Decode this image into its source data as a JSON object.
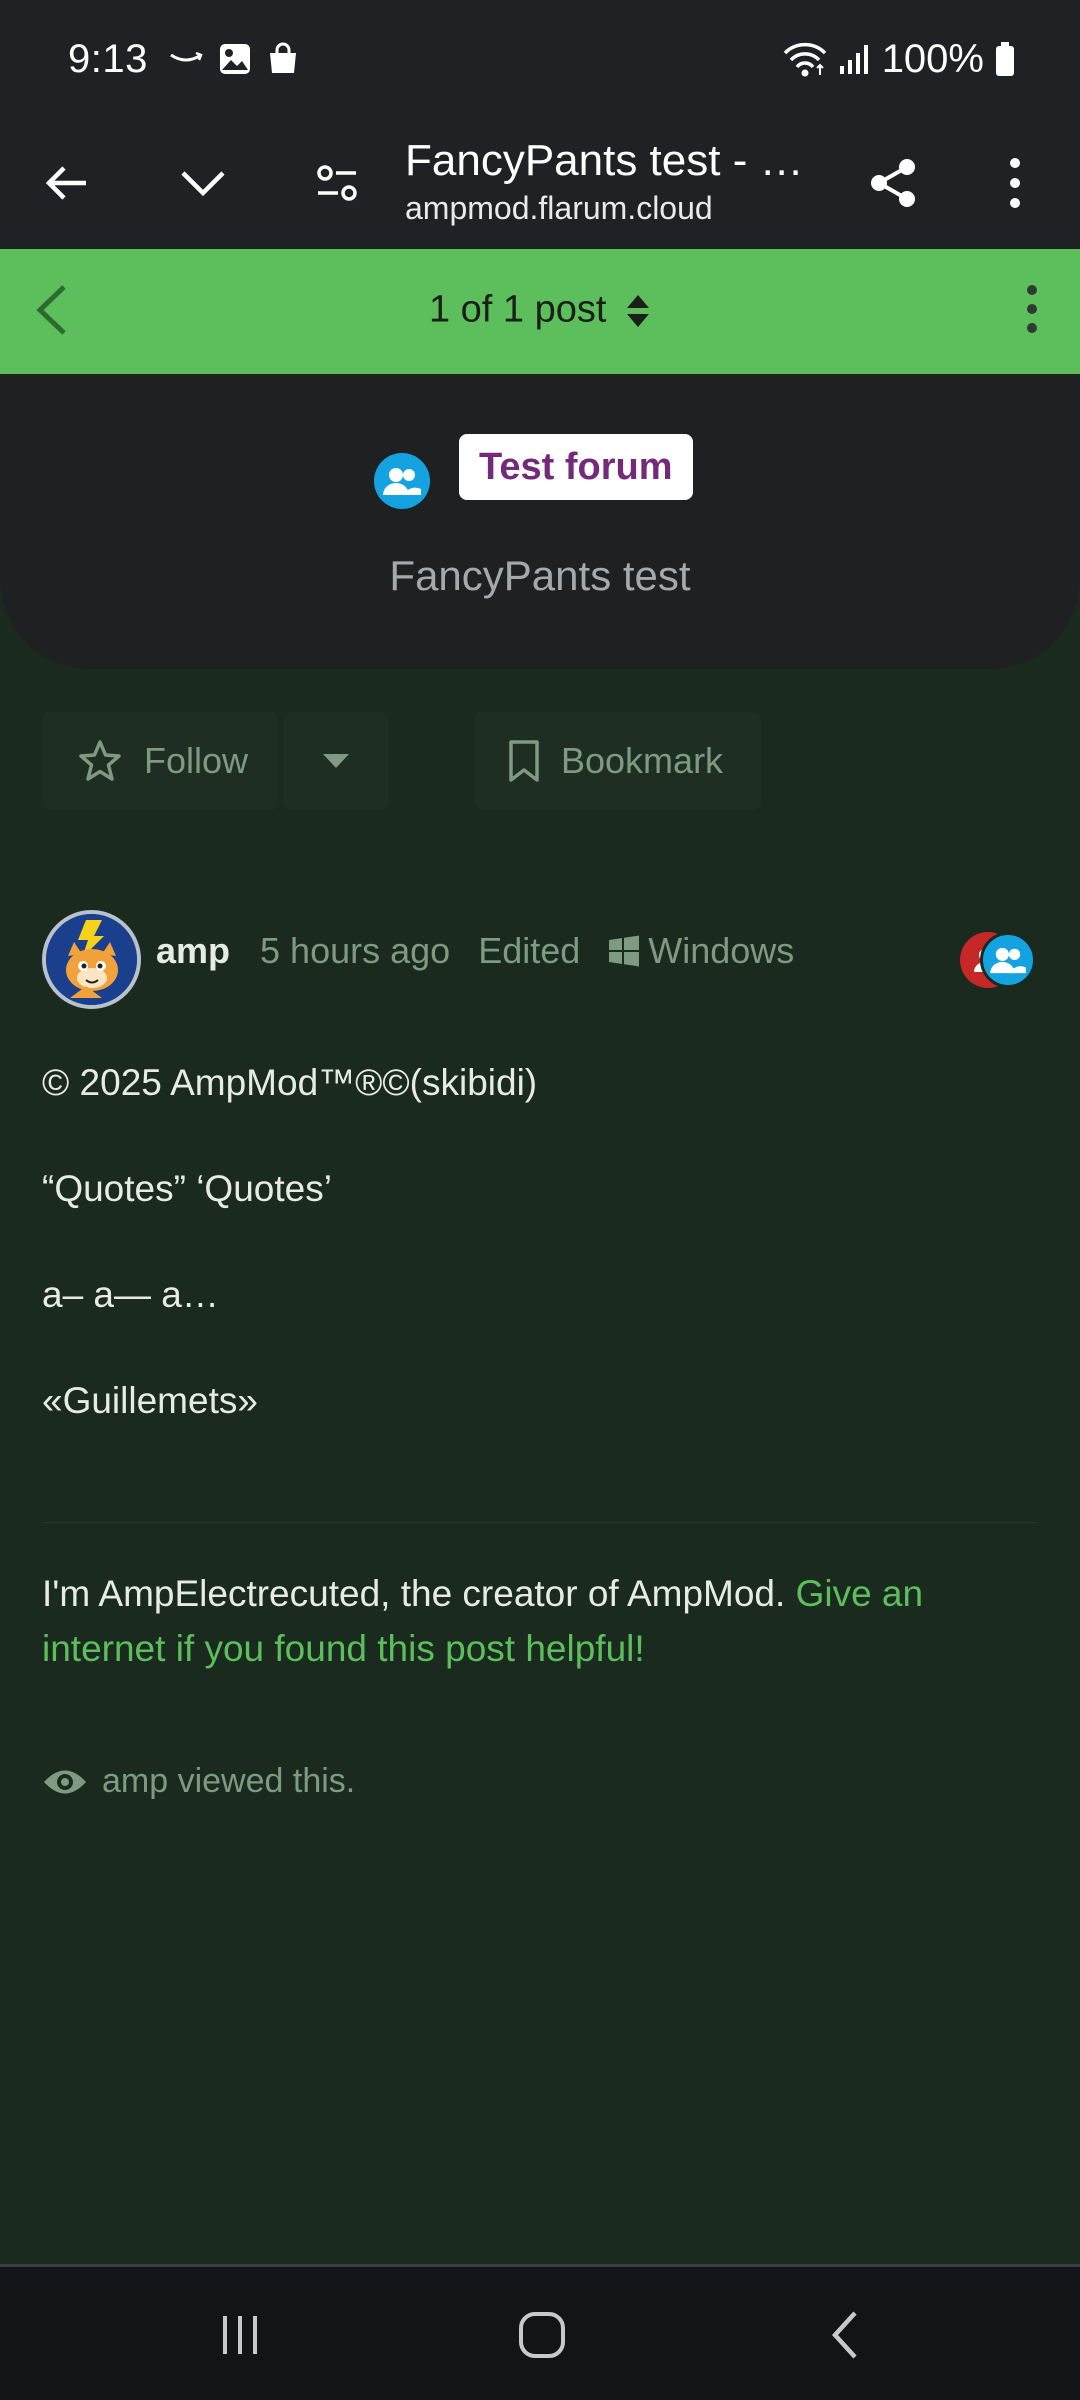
{
  "status_bar": {
    "time": "9:13",
    "battery": "100%"
  },
  "browser": {
    "title": "FancyPants test - …",
    "url": "ampmod.flarum.cloud"
  },
  "post_nav": {
    "count_label": "1 of 1 post"
  },
  "discussion": {
    "tag": "Test forum",
    "title": "FancyPants test",
    "follow_label": "Follow",
    "bookmark_label": "Bookmark"
  },
  "post": {
    "username": "amp",
    "time": "5 hours ago",
    "edited": "Edited",
    "platform": "Windows",
    "body": [
      "© 2025 AmpMod™®©(skibidi)",
      "“Quotes” ‘Quotes’",
      "a– a— a…",
      "«Guillemets»"
    ],
    "signature_text": "I'm AmpElectrecuted, the creator of AmpMod. ",
    "signature_link": "Give an internet if you found this post helpful!",
    "viewed_by": "amp viewed this."
  },
  "colors": {
    "accent": "#5cbf5c",
    "page_bg": "#1b2a1e",
    "tag_text": "#742a7a",
    "tag_icon_bg": "#14a3e0",
    "muted": "#7e9a80"
  },
  "icons": [
    "back-arrow-icon",
    "chevron-down-icon",
    "tune-icon",
    "share-icon",
    "more-vert-icon",
    "chevron-left-icon",
    "sort-icon",
    "group-icon",
    "star-icon",
    "caret-down-icon",
    "bookmark-icon",
    "windows-icon",
    "eye-icon",
    "recents-icon",
    "home-icon",
    "nav-back-icon"
  ]
}
